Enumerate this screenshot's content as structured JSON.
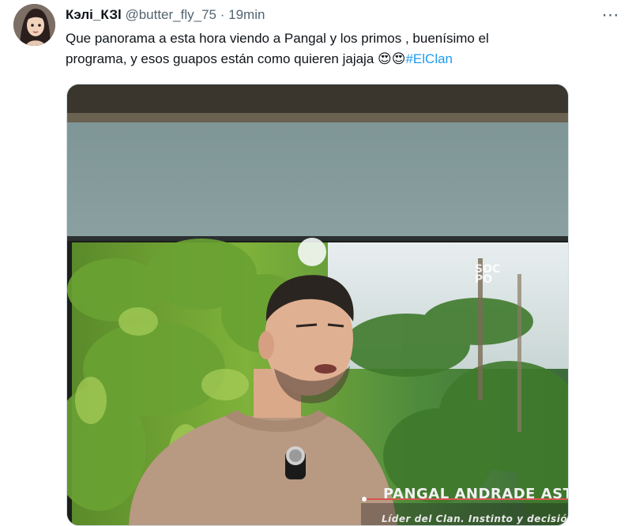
{
  "tweet": {
    "display_name": "Кэлі_КЗl",
    "handle": "@butter_fly_75",
    "separator": "·",
    "time": "19min",
    "text_line1": "Que panorama a esta hora viendo a Pangal y los primos , buenísimo el",
    "text_line2": "programa, y esos guapos están  como quieren jajaja ",
    "emojis": "😍😍",
    "hashtag": "#ElClan",
    "more_icon": "⋯"
  },
  "media": {
    "watermark_line1": "SOC",
    "watermark_line2": "PO",
    "caption_name": "PANGAL ANDRADE ASTORGA",
    "caption_role": "Líder del Clan. Instinto y decisión."
  },
  "colors": {
    "link": "#1d9bf0",
    "muted": "#536471",
    "text": "#0f1419"
  }
}
